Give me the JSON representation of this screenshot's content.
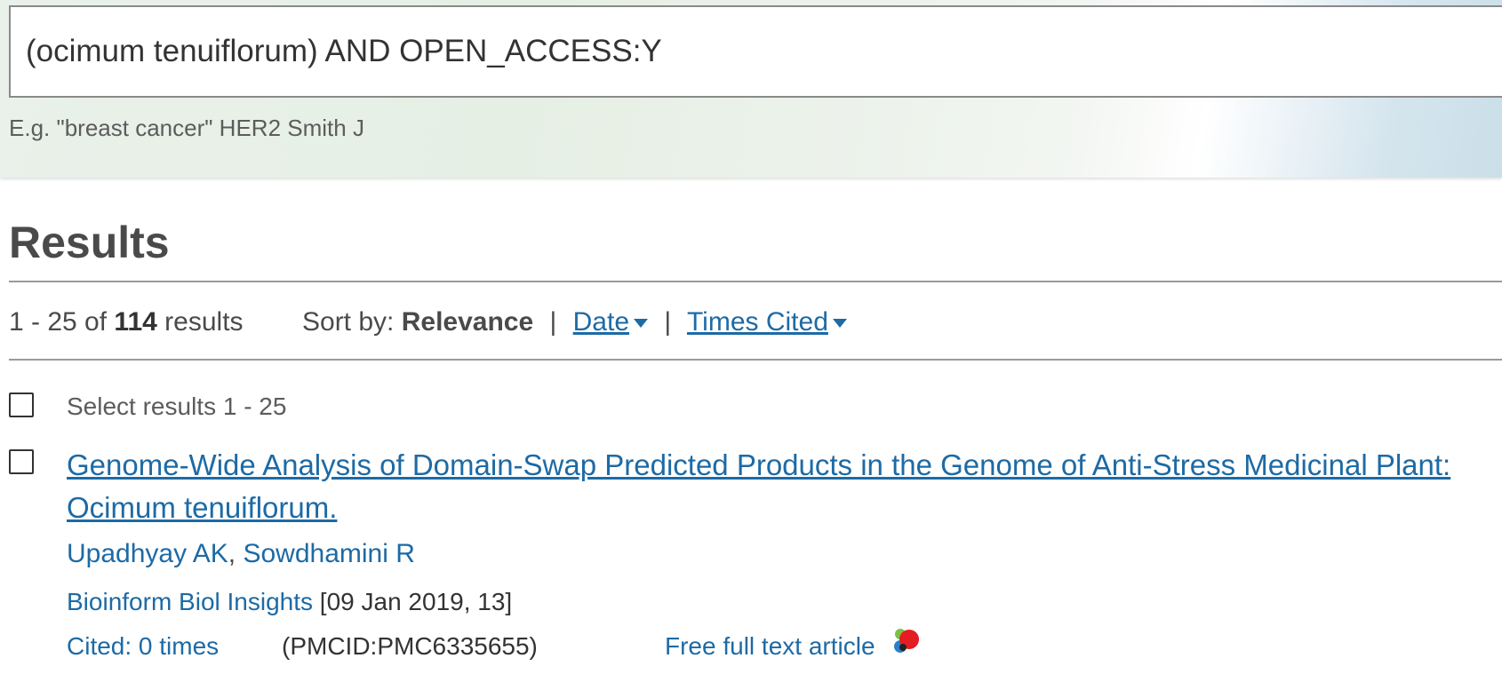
{
  "search": {
    "query": "(ocimum tenuiflorum) AND OPEN_ACCESS:Y",
    "hint": "E.g. \"breast cancer\" HER2 Smith J"
  },
  "results": {
    "heading": "Results",
    "range": "1 - 25 of",
    "total": "114",
    "suffix": "results"
  },
  "sort": {
    "label": "Sort by:",
    "active": "Relevance",
    "separator": "|",
    "options": [
      "Date",
      "Times Cited"
    ]
  },
  "select_all": {
    "label": "Select results 1 - 25"
  },
  "articles": [
    {
      "title": "Genome-Wide Analysis of Domain-Swap Predicted Products in the Genome of Anti-Stress Medicinal Plant: Ocimum tenuiflorum.",
      "authors": [
        "Upadhyay AK",
        "Sowdhamini R"
      ],
      "author_separator": ", ",
      "journal": "Bioinform Biol Insights",
      "details": "[09 Jan 2019, 13]",
      "cited": "Cited: 0 times",
      "pmcid": "(PMCID:PMC6335655)",
      "fulltext": "Free full text article",
      "fulltext_icon": "europe-pmc-full-text-icon"
    }
  ],
  "colors": {
    "link": "#1d6aa5",
    "text": "#4a4a4a",
    "rule": "#9a9a9a"
  }
}
